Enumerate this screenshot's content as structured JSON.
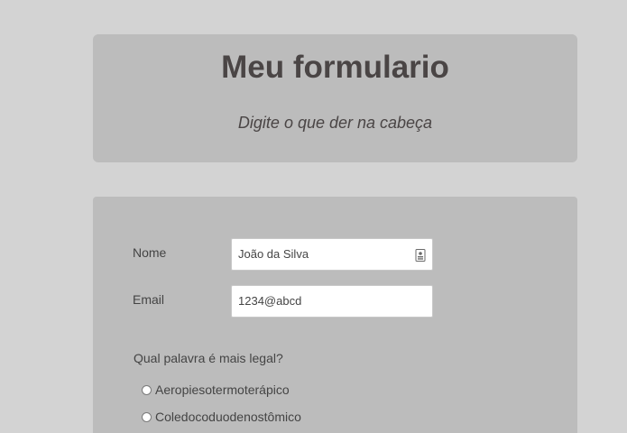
{
  "header": {
    "title": "Meu formulario",
    "subtitle": "Digite o que der na cabeça"
  },
  "form": {
    "fields": [
      {
        "label": "Nome",
        "value": "João da Silva",
        "icon": "contact-card-icon"
      },
      {
        "label": "Email",
        "value": "1234@abcd"
      }
    ],
    "question": "Qual palavra é mais legal?",
    "options": [
      {
        "label": "Aeropiesotermoterápico",
        "selected": false
      },
      {
        "label": "Coledocoduodenostômico",
        "selected": false
      }
    ]
  },
  "colors": {
    "background": "#d3d3d3",
    "card": "#bcbcbc",
    "title_text": "#4a4545"
  }
}
